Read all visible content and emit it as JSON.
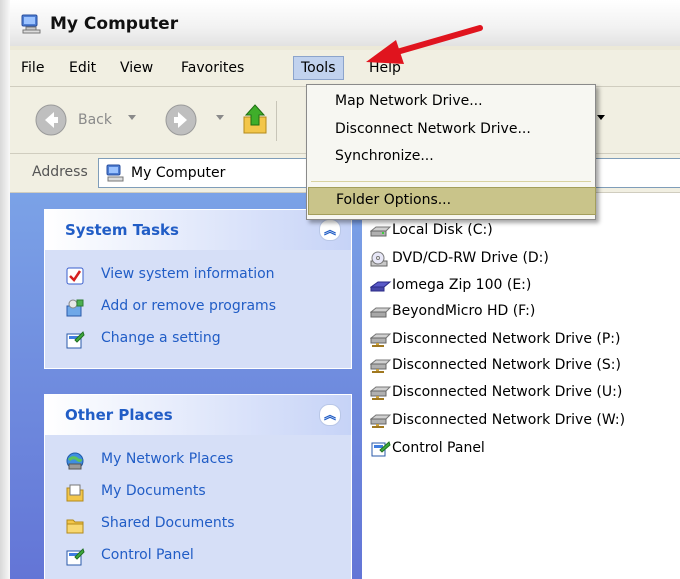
{
  "window": {
    "title": "My Computer"
  },
  "menubar": {
    "items": [
      {
        "label": "File"
      },
      {
        "label": "Edit"
      },
      {
        "label": "View"
      },
      {
        "label": "Favorites"
      },
      {
        "label": "Tools",
        "active": true
      },
      {
        "label": "Help"
      }
    ]
  },
  "toolbar": {
    "back_label": "Back"
  },
  "address": {
    "label": "Address",
    "value": "My Computer"
  },
  "tools_menu": {
    "items": [
      {
        "label": "Map Network Drive..."
      },
      {
        "label": "Disconnect Network Drive..."
      },
      {
        "label": "Synchronize..."
      },
      {
        "label": "Folder Options...",
        "highlighted": true
      }
    ]
  },
  "system_tasks": {
    "title": "System Tasks",
    "collapse_glyph": "︽",
    "items": [
      {
        "label": "View system information",
        "icon": "system-info-icon"
      },
      {
        "label": "Add or remove programs",
        "icon": "add-remove-programs-icon"
      },
      {
        "label": "Change a setting",
        "icon": "control-panel-icon"
      }
    ]
  },
  "other_places": {
    "title": "Other Places",
    "collapse_glyph": "︽",
    "items": [
      {
        "label": "My Network Places",
        "icon": "network-places-icon"
      },
      {
        "label": "My Documents",
        "icon": "documents-icon"
      },
      {
        "label": "Shared Documents",
        "icon": "folder-icon"
      },
      {
        "label": "Control Panel",
        "icon": "control-panel-icon"
      }
    ]
  },
  "drives": [
    {
      "label": "Local Disk (C:)",
      "icon": "hard-disk-icon"
    },
    {
      "label": "DVD/CD-RW Drive (D:)",
      "icon": "cd-drive-icon"
    },
    {
      "label": "Iomega Zip 100 (E:)",
      "icon": "zip-drive-icon"
    },
    {
      "label": "BeyondMicro HD (F:)",
      "icon": "removable-disk-icon"
    },
    {
      "label": "Disconnected Network Drive (P:)",
      "icon": "network-drive-icon"
    },
    {
      "label": "Disconnected Network Drive (S:)",
      "icon": "network-drive-icon"
    },
    {
      "label": "Disconnected Network Drive (U:)",
      "icon": "network-drive-icon"
    },
    {
      "label": "Disconnected Network Drive (W:)",
      "icon": "network-drive-icon"
    },
    {
      "label": "Control Panel",
      "icon": "control-panel-icon"
    }
  ],
  "colors": {
    "task_link": "#215dc6",
    "highlight": "#c9c48a",
    "arrow": "#e0141e"
  }
}
